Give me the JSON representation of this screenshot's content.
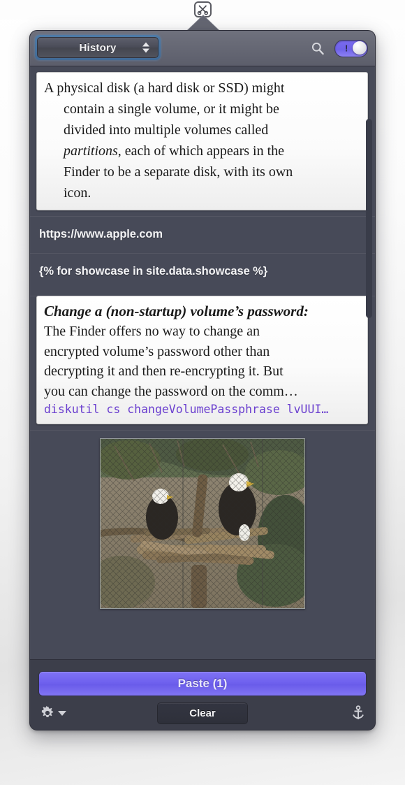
{
  "app": {
    "status_icon": "scissors-pin-close-icon",
    "window_title": "Clipboard History Popup"
  },
  "header": {
    "source_select_label": "History",
    "source_select_icon": "stepper-up-down-icon",
    "search_icon": "search-icon",
    "pin_toggle": {
      "name": "pin-toggle",
      "state": "on",
      "glyph": "!",
      "accent_color": "#7a6bf0"
    }
  },
  "clips": [
    {
      "type": "rich-text",
      "kind": "card",
      "lines": [
        "A physical disk (a hard disk or SSD) might",
        "contain a single volume, or it might be",
        "divided into multiple volumes called",
        "partitions, each of which appears in the",
        "Finder to be a separate disk, with its own",
        "icon."
      ],
      "italic_word": "partitions"
    },
    {
      "type": "plain-text",
      "text": "https://www.apple.com"
    },
    {
      "type": "plain-text",
      "text": "{% for showcase in site.data.showcase %}"
    },
    {
      "type": "rich-text",
      "kind": "card",
      "heading": "Change a (non-startup) volume’s password:",
      "body_lines": [
        "The Finder offers no way to change an",
        "encrypted volume’s password other than",
        "decrypting it and then re-encrypting it. But",
        "you can change the password on the comm…"
      ],
      "code": "diskutil cs changeVolumePassphrase lvUUI…",
      "code_color": "#6a3fcf"
    },
    {
      "type": "image",
      "alt": "Two bald eagles perched on logs behind a chain-link fence"
    }
  ],
  "scrollbar": {
    "name": "list-scrollbar",
    "thumb_color": "#393c49"
  },
  "footer": {
    "paste_label": "Paste (1)",
    "paste_color": "#6f61ee",
    "clear_label": "Clear",
    "gear_icon": "gear-icon",
    "gear_dropdown_icon": "triangle-down-icon",
    "anchor_icon": "anchor-icon"
  }
}
